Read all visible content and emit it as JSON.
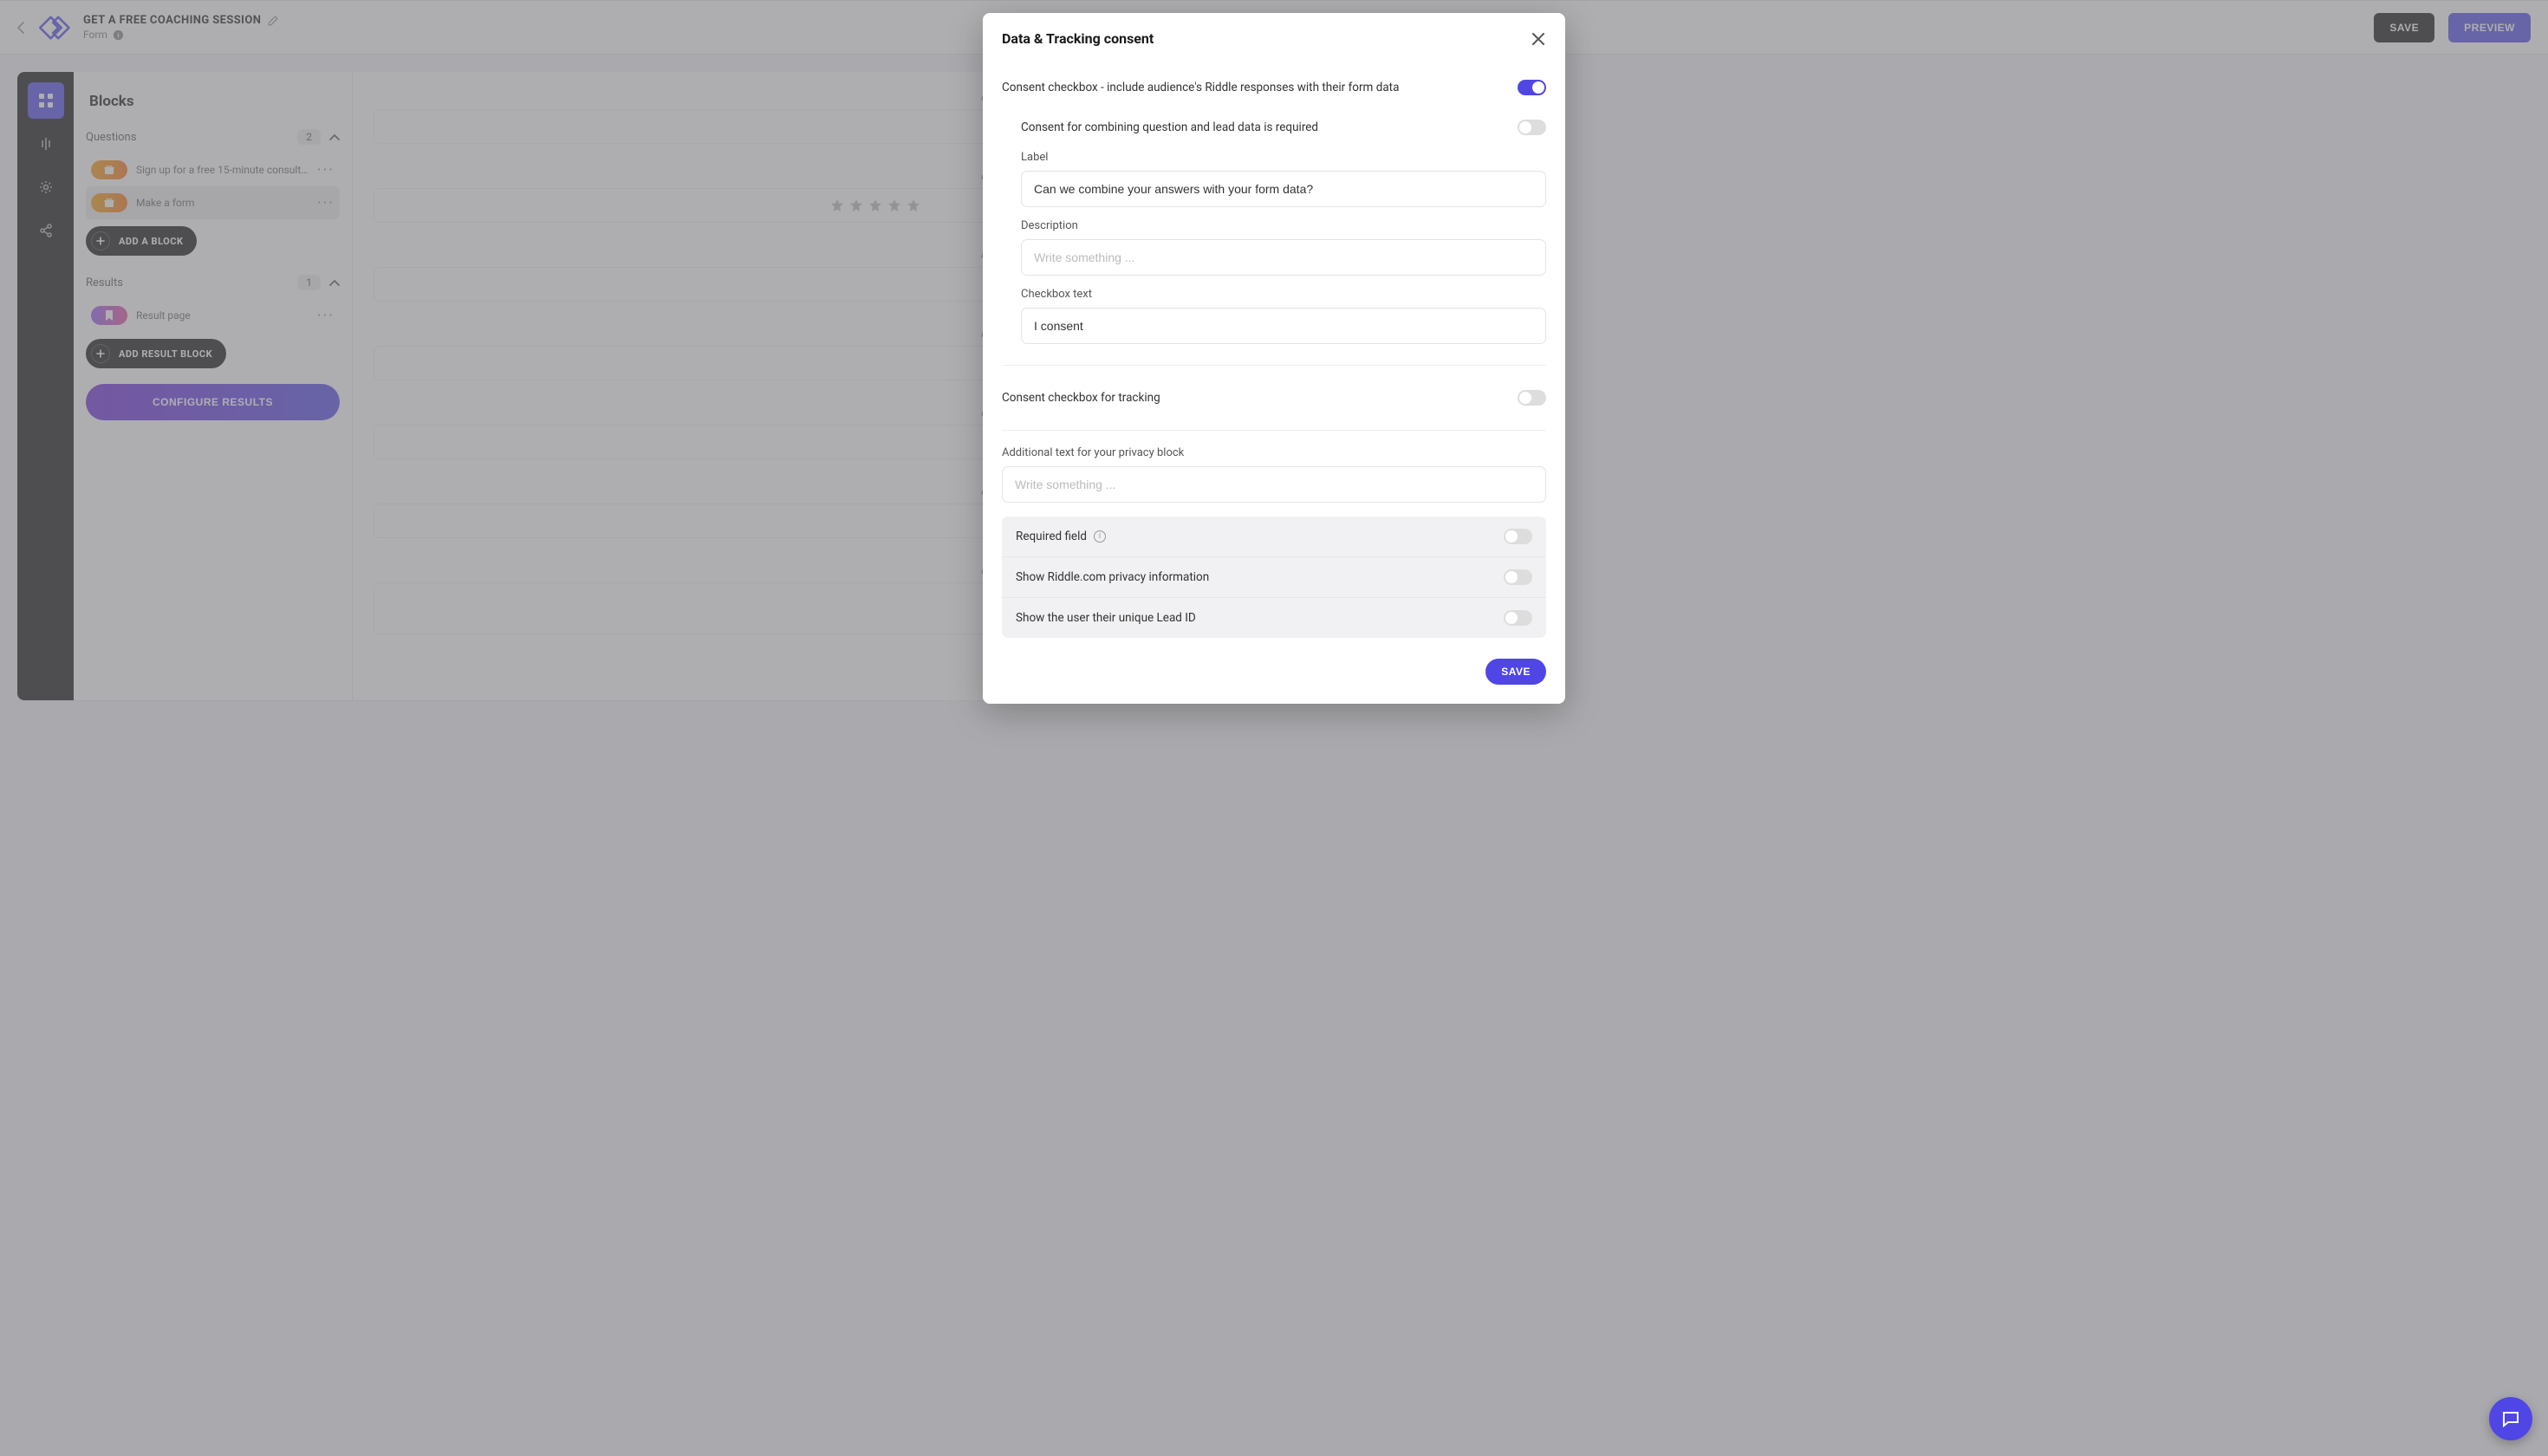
{
  "header": {
    "title": "GET A FREE COACHING SESSION",
    "subtitle": "Form",
    "save_label": "SAVE",
    "preview_label": "PREVIEW"
  },
  "blocks": {
    "title": "Blocks",
    "questions_label": "Questions",
    "questions_count": "2",
    "results_label": "Results",
    "results_count": "1",
    "items": {
      "q1": "Sign up for a free 15-minute consult…",
      "q2": "Make a form",
      "r1": "Result page"
    },
    "add_block_label": "ADD A BLOCK",
    "add_result_label": "ADD RESULT BLOCK",
    "configure_label": "CONFIGURE RESULTS"
  },
  "modal": {
    "title": "Data & Tracking consent",
    "consent_checkbox_label": "Consent checkbox - include audience's Riddle responses with their form data",
    "combine_required_label": "Consent for combining question and lead data is required",
    "label_label": "Label",
    "label_value": "Can we combine your answers with your form data?",
    "description_label": "Description",
    "description_placeholder": "Write something ...",
    "checkbox_text_label": "Checkbox text",
    "checkbox_text_value": "I consent",
    "tracking_label": "Consent checkbox for tracking",
    "privacy_block_label": "Additional text for your privacy block",
    "privacy_block_placeholder": "Write something ...",
    "required_field_label": "Required field",
    "show_riddle_privacy_label": "Show Riddle.com privacy information",
    "show_lead_id_label": "Show the user their unique Lead ID",
    "save_label": "SAVE"
  },
  "icons": {
    "back": "chevron-left",
    "edit": "pencil",
    "info": "info",
    "grid": "grid",
    "layers": "layers",
    "gear": "gear",
    "share": "share",
    "gift": "gift",
    "bookmark": "bookmark",
    "plus": "plus",
    "close": "close",
    "clock": "clock",
    "star": "star",
    "chat": "chat",
    "caret_up": "caret-up",
    "caret_down": "caret-down"
  },
  "toggles": {
    "consent_checkbox": true,
    "combine_required": false,
    "tracking": false,
    "required_field": false,
    "riddle_privacy": false,
    "lead_id": false
  }
}
